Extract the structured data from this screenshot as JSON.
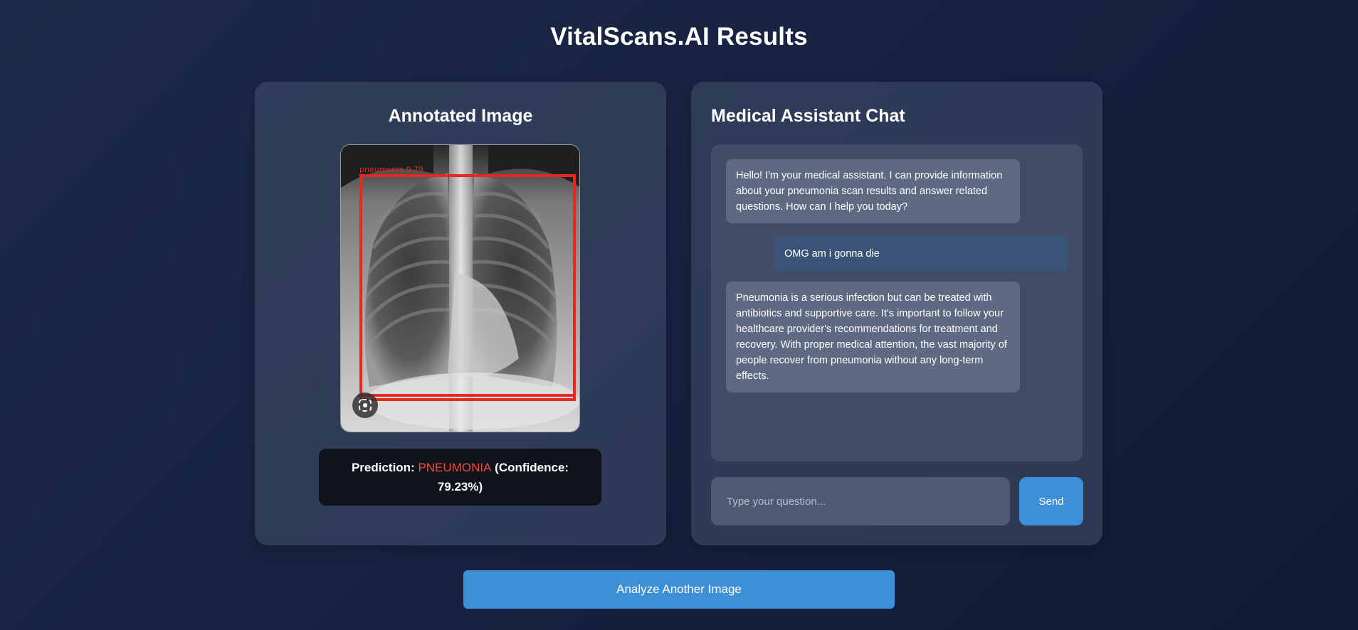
{
  "page": {
    "title": "VitalScans.AI Results"
  },
  "annotated": {
    "title": "Annotated Image",
    "overlay_label": "pneumonia 0.79",
    "prediction": {
      "label": "Prediction:",
      "value": "PNEUMONIA",
      "confidence": "(Confidence: 79.23%)"
    }
  },
  "chat": {
    "title": "Medical Assistant Chat",
    "messages": [
      {
        "role": "assistant",
        "text": "Hello! I'm your medical assistant. I can provide information about your pneumonia scan results and answer related questions. How can I help you today?"
      },
      {
        "role": "user",
        "text": "OMG am i gonna die"
      },
      {
        "role": "assistant",
        "text": "Pneumonia is a serious infection but can be treated with antibiotics and supportive care. It's important to follow your healthcare provider's recommendations for treatment and recovery. With proper medical attention, the vast majority of people recover from pneumonia without any long-term effects."
      }
    ],
    "input_placeholder": "Type your question...",
    "input_value": "",
    "send_label": "Send"
  },
  "actions": {
    "analyze_label": "Analyze Another Image"
  },
  "icons": {
    "lens": "lens-icon"
  },
  "colors": {
    "accent": "#3d8fd6",
    "prediction": "#ef4b3f",
    "bbox": "#e8281e"
  }
}
